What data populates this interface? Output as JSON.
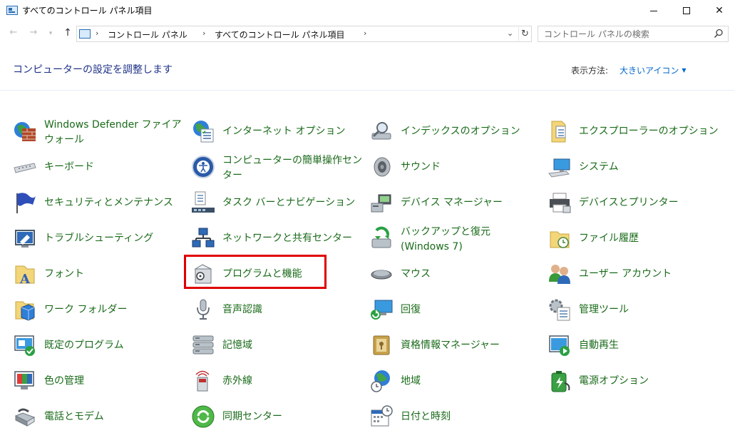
{
  "window": {
    "title": "すべてのコントロール パネル項目"
  },
  "address_bar": {
    "crumbs": [
      "コントロール パネル",
      "すべてのコントロール パネル項目"
    ]
  },
  "search": {
    "placeholder": "コントロール パネルの検索"
  },
  "header": {
    "title": "コンピューターの設定を調整します",
    "view_by_label": "表示方法:",
    "view_by_value": "大きいアイコン"
  },
  "items": [
    [
      "Windows Defender ファイアウォール",
      "インターネット オプション",
      "インデックスのオプション",
      "エクスプローラーのオプション"
    ],
    [
      "キーボード",
      "コンピューターの簡単操作センター",
      "サウンド",
      "システム"
    ],
    [
      "セキュリティとメンテナンス",
      "タスク バーとナビゲーション",
      "デバイス マネージャー",
      "デバイスとプリンター"
    ],
    [
      "トラブルシューティング",
      "ネットワークと共有センター",
      "バックアップと復元 (Windows 7)",
      "ファイル履歴"
    ],
    [
      "フォント",
      "プログラムと機能",
      "マウス",
      "ユーザー アカウント"
    ],
    [
      "ワーク フォルダー",
      "音声認識",
      "回復",
      "管理ツール"
    ],
    [
      "既定のプログラム",
      "記憶域",
      "資格情報マネージャー",
      "自動再生"
    ],
    [
      "色の管理",
      "赤外線",
      "地域",
      "電源オプション"
    ],
    [
      "電話とモデム",
      "同期センター",
      "日付と時刻",
      ""
    ]
  ],
  "colors": {
    "link_green": "#1a6b1a",
    "heading_blue": "#1e3287",
    "accent_blue": "#0066cc",
    "highlight_red": "#e00000"
  }
}
